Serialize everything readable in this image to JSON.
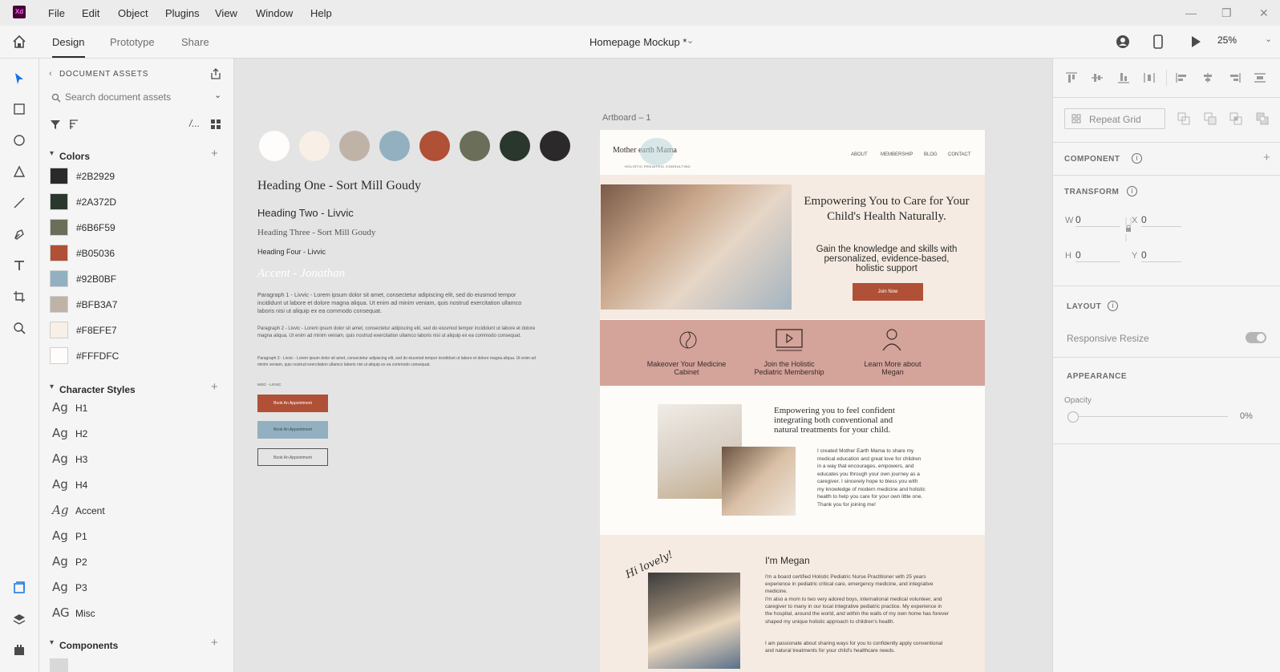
{
  "menu": [
    "File",
    "Edit",
    "Object",
    "Plugins",
    "View",
    "Window",
    "Help"
  ],
  "window": {
    "minimize": "—",
    "restore": "❐",
    "close": "✕"
  },
  "toolbar": {
    "modes": [
      "Design",
      "Prototype",
      "Share"
    ],
    "doc_title": "Homepage Mockup *",
    "zoom": "25%"
  },
  "assets": {
    "header": "DOCUMENT ASSETS",
    "search_placeholder": "Search document assets",
    "colors_label": "Colors",
    "colors": [
      {
        "hex": "#2B2929"
      },
      {
        "hex": "#2A372D"
      },
      {
        "hex": "#6B6F59"
      },
      {
        "hex": "#B05036"
      },
      {
        "hex": "#92B0BF"
      },
      {
        "hex": "#BFB3A7"
      },
      {
        "hex": "#F8EFE7"
      },
      {
        "hex": "#FFFDFC"
      }
    ],
    "char_label": "Character Styles",
    "char_styles": [
      {
        "ag": "Ag",
        "name": "H1"
      },
      {
        "ag": "Ag",
        "name": "H2"
      },
      {
        "ag": "Ag",
        "name": "H3"
      },
      {
        "ag": "Ag",
        "name": "H4"
      },
      {
        "ag": "Ag",
        "name": "Accent"
      },
      {
        "ag": "Ag",
        "name": "P1"
      },
      {
        "ag": "Ag",
        "name": "P2"
      },
      {
        "ag": "Ag",
        "name": "P3"
      },
      {
        "ag": "AG",
        "name": "Misc"
      }
    ],
    "components_label": "Components"
  },
  "styleguide": {
    "swatches": [
      "#FFFDFC",
      "#F8EFE7",
      "#BFB3A7",
      "#92B0BF",
      "#B05036",
      "#6B6F59",
      "#2A372D",
      "#2B2929"
    ],
    "h1": "Heading One - Sort Mill Goudy",
    "h2": "Heading Two - Livvic",
    "h3": "Heading Three - Sort Mill Goudy",
    "h4": "Heading Four - Livvic",
    "accent": "Accent - Jonathan",
    "p1": "Paragraph 1 - Livvic - Lorem ipsum dolor sit amet, consectetur adipiscing elit, sed do eiusmod tempor incididunt ut labore et dolore magna aliqua. Ut enim ad minim veniam, quis nostrud exercitation ullamco laboris nisi ut aliquip ex ea commodo consequat.",
    "p2": "Paragraph 2 - Livvic - Lorem ipsum dolor sit amet, consectetur adipiscing elit, sed do eiusmod tempor incididunt ut labore et dolore magna aliqua. Ut enim ad minim veniam, quis nostrud exercitation ullamco laboris nisi ut aliquip ex ea commodo consequat.",
    "p3": "Paragraph 3 - Livvic - Lorem ipsum dolor sit amet, consectetur adipiscing elit, sed do eiusmod tempor incididunt ut labore et dolore magna aliqua. Ut enim ad minim veniam, quis nostrud exercitation ullamco laboris nisi ut aliquip ex ea commodo consequat.",
    "misc": "MISC - LIVVIC",
    "button": "Book An Appointment"
  },
  "artboard": {
    "label": "Artboard – 1",
    "logo": "Mother earth Mama",
    "logo_sub": "HOLISTIC PEDIATRIC CONSULTING",
    "nav": [
      "ABOUT",
      "MEMBERSHIP",
      "BLOG",
      "CONTACT"
    ],
    "hero_title": "Empowering You to Care for Your Child's Health Naturally.",
    "hero_sub": "Gain the knowledge and skills with personalized, evidence-based, holistic support",
    "hero_btn": "Join Now",
    "band": [
      "Makeover Your Medicine Cabinet",
      "Join the Holistic Pediatric Membership",
      "Learn More about Megan"
    ],
    "sec3_title": "Empowering you to feel confident integrating both conventional and natural treatments for your child.",
    "sec3_body": "I created Mother Earth Mama to share my medical education and great love for children in a way that encourages, empowers, and educates you through your own journey as a caregiver. I sincerely hope to bless you with my knowledge of modern medicine and holistic health to help you care for your own little one. Thank you for joining me!",
    "sec4_script": "Hi lovely!",
    "sec4_title": "I'm Megan",
    "sec4_p1": "I'm a board certified Holistic Pediatric Nurse Practitioner with 25 years experience in pediatric critical care, emergency medicine, and integrative medicine.",
    "sec4_p2": "I'm also a mom to two very adored boys, international medical volunteer, and caregiver to many in our local integrative pediatric practice. My experience in the hospital, around the world, and within the walls of my own home has forever shaped my unique holistic approach to children's health.",
    "sec4_p3": "I am passionate about sharing ways for you to confidently apply conventional and natural treatments for your child's healthcare needs."
  },
  "props": {
    "repeat_grid": "Repeat Grid",
    "component": "COMPONENT",
    "transform": "TRANSFORM",
    "w_label": "W",
    "w_val": "0",
    "x_label": "X",
    "x_val": "0",
    "h_label": "H",
    "h_val": "0",
    "y_label": "Y",
    "y_val": "0",
    "layout": "LAYOUT",
    "responsive": "Responsive Resize",
    "appearance": "APPEARANCE",
    "opacity_label": "Opacity",
    "opacity_val": "0%"
  }
}
